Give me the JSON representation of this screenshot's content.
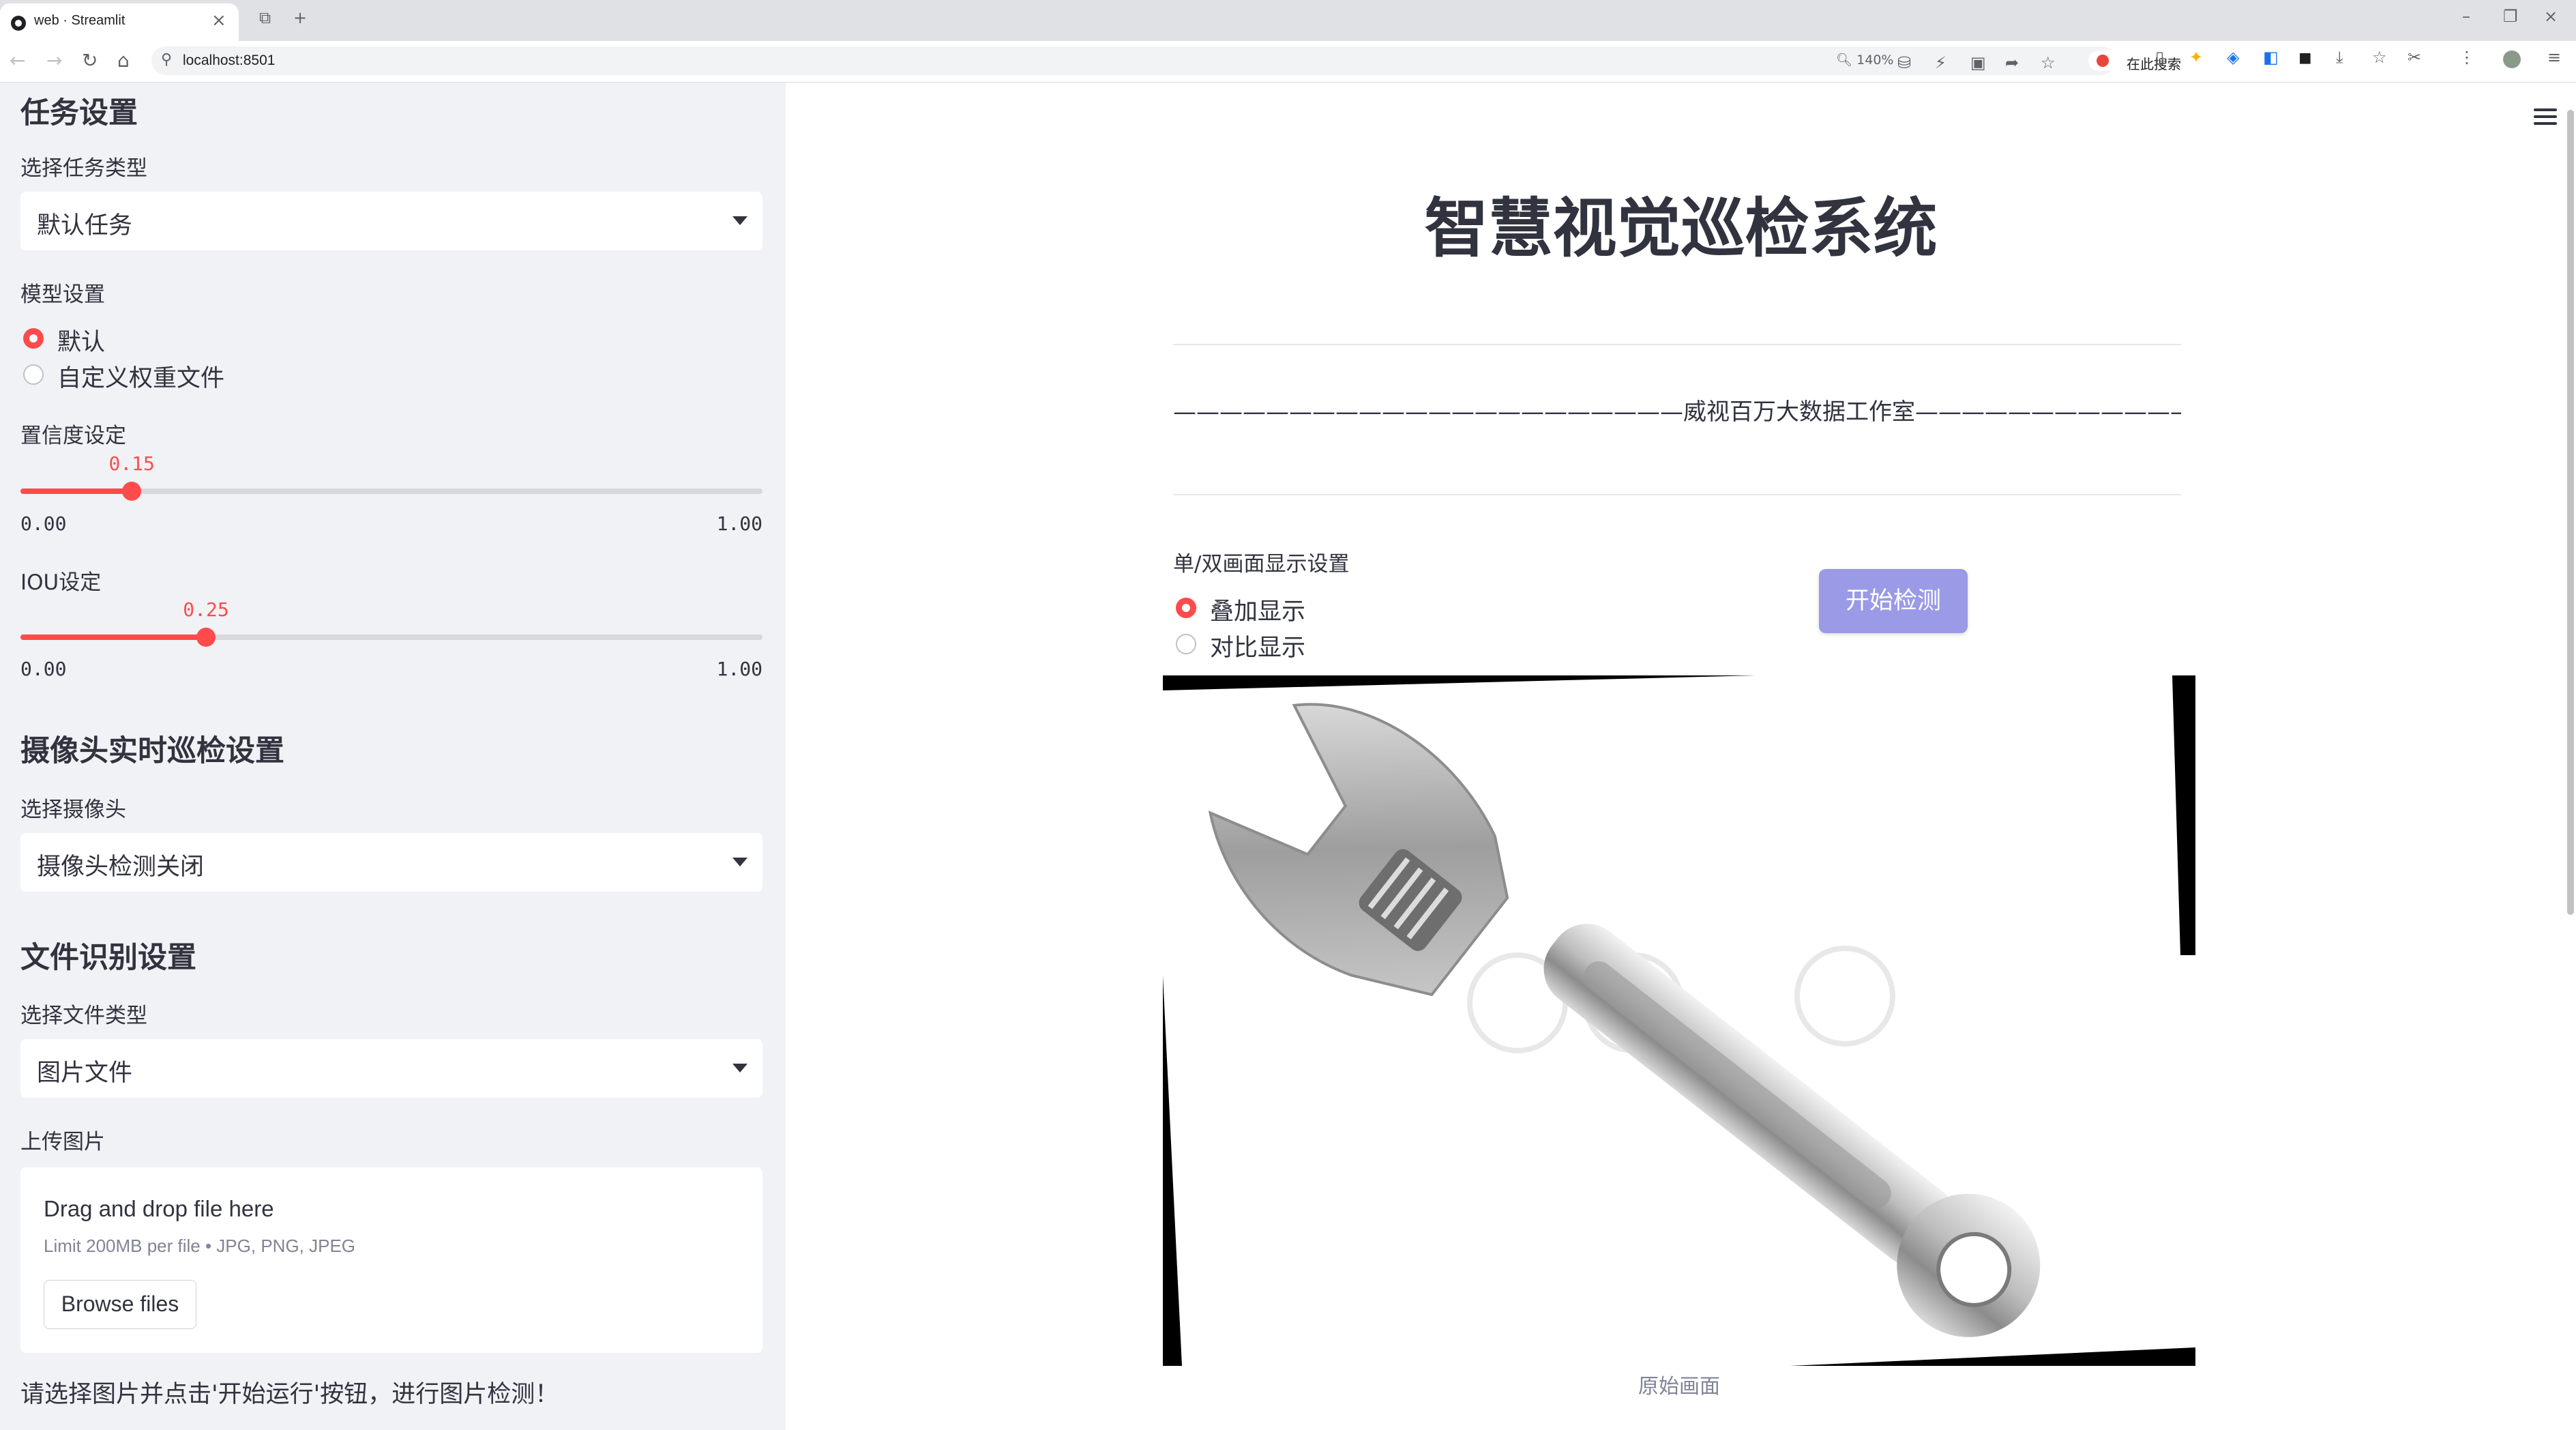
{
  "browser": {
    "tab_title": "web · Streamlit",
    "url": "localhost:8501",
    "zoom": "140%",
    "search_placeholder": "在此搜索"
  },
  "sidebar": {
    "task_section": {
      "heading": "任务设置",
      "task_type_label": "选择任务类型",
      "task_type_value": "默认任务"
    },
    "model": {
      "label": "模型设置",
      "options": [
        "默认",
        "自定义权重文件"
      ],
      "selected": 0
    },
    "confidence": {
      "label": "置信度设定",
      "value": 0.15,
      "value_text": "0.15",
      "min": "0.00",
      "max": "1.00"
    },
    "iou": {
      "label": "IOU设定",
      "value": 0.25,
      "value_text": "0.25",
      "min": "0.00",
      "max": "1.00"
    },
    "camera_section": {
      "heading": "摄像头实时巡检设置",
      "label": "选择摄像头",
      "value": "摄像头检测关闭"
    },
    "file_section": {
      "heading": "文件识别设置",
      "label": "选择文件类型",
      "value": "图片文件"
    },
    "upload": {
      "label": "上传图片",
      "title": "Drag and drop file here",
      "limit": "Limit 200MB per file • JPG, PNG, JPEG",
      "button": "Browse files"
    },
    "note": "请选择图片并点击'开始运行'按钮，进行图片检测！"
  },
  "main": {
    "title": "智慧视觉巡检系统",
    "banner": "——————————————————————威视百万大数据工作室——————————————————————",
    "display_mode": {
      "label": "单/双画面显示设置",
      "options": [
        "叠加显示",
        "对比显示"
      ],
      "selected": 0
    },
    "start_button": "开始检测",
    "image_caption": "原始画面"
  },
  "colors": {
    "accent": "#ff4b4b",
    "start_button": "#9a9ae6",
    "sidebar_bg": "#f0f2f6"
  }
}
